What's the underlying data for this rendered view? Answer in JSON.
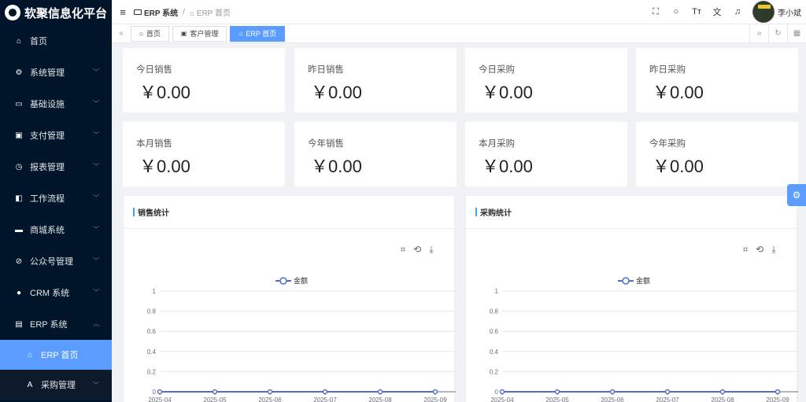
{
  "app": {
    "name": "软聚信息化平台"
  },
  "sidebar": {
    "items": [
      {
        "label": "首页",
        "icon": "home-icon",
        "glyph": "⌂",
        "has_children": false
      },
      {
        "label": "系统管理",
        "icon": "gear-icon",
        "glyph": "⚙",
        "has_children": true
      },
      {
        "label": "基础设施",
        "icon": "monitor-icon",
        "glyph": "▭",
        "has_children": true
      },
      {
        "label": "支付管理",
        "icon": "payment-icon",
        "glyph": "▣",
        "has_children": true
      },
      {
        "label": "报表管理",
        "icon": "report-icon",
        "glyph": "◷",
        "has_children": true
      },
      {
        "label": "工作流程",
        "icon": "workflow-icon",
        "glyph": "◧",
        "has_children": true
      },
      {
        "label": "商城系统",
        "icon": "shop-icon",
        "glyph": "▬",
        "has_children": true
      },
      {
        "label": "公众号管理",
        "icon": "compass-icon",
        "glyph": "⊘",
        "has_children": true
      },
      {
        "label": "CRM 系统",
        "icon": "user-icon",
        "glyph": "●",
        "has_children": true
      },
      {
        "label": "ERP 系统",
        "icon": "erp-icon",
        "glyph": "▤",
        "has_children": true,
        "expanded": true
      }
    ],
    "erp_children": [
      {
        "label": "ERP 首页",
        "icon": "home-icon",
        "glyph": "⌂",
        "active": true
      },
      {
        "label": "采购管理",
        "icon": "purchase-icon",
        "glyph": "A",
        "has_children": true
      }
    ]
  },
  "topbar": {
    "breadcrumb": [
      "ERP 系统",
      "ERP 首页"
    ],
    "username": "李小斌",
    "icons": [
      "fullscreen-icon",
      "search-icon",
      "font-size-icon",
      "translate-icon",
      "bell-icon"
    ]
  },
  "tabs": [
    {
      "label": "首页",
      "icon": "home-icon",
      "glyph": "⌂",
      "active": false
    },
    {
      "label": "客户管理",
      "icon": "card-icon",
      "glyph": "▣",
      "active": false
    },
    {
      "label": "ERP 首页",
      "icon": "home-icon",
      "glyph": "⌂",
      "active": true
    }
  ],
  "stats": [
    {
      "label": "今日销售",
      "value": "￥0.00"
    },
    {
      "label": "昨日销售",
      "value": "￥0.00"
    },
    {
      "label": "今日采购",
      "value": "￥0.00"
    },
    {
      "label": "昨日采购",
      "value": "￥0.00"
    },
    {
      "label": "本月销售",
      "value": "￥0.00"
    },
    {
      "label": "今年销售",
      "value": "￥0.00"
    },
    {
      "label": "本月采购",
      "value": "￥0.00"
    },
    {
      "label": "今年采购",
      "value": "￥0.00"
    }
  ],
  "chart_data": [
    {
      "type": "line",
      "title": "销售统计",
      "x": [
        "2025-04",
        "2025-05",
        "2025-06",
        "2025-07",
        "2025-08",
        "2025-09"
      ],
      "series": [
        {
          "name": "金额",
          "values": [
            0,
            0,
            0,
            0,
            0,
            0
          ]
        }
      ],
      "ylim": [
        0,
        1
      ],
      "yticks": [
        "0",
        "0.2",
        "0.4",
        "0.6",
        "0.8",
        "1"
      ],
      "legend": "top-center",
      "grid": true,
      "color": "#5470c6"
    },
    {
      "type": "line",
      "title": "采购统计",
      "x": [
        "2025-04",
        "2025-05",
        "2025-06",
        "2025-07",
        "2025-08",
        "2025-09"
      ],
      "series": [
        {
          "name": "金额",
          "values": [
            0,
            0,
            0,
            0,
            0,
            0
          ]
        }
      ],
      "ylim": [
        0,
        1
      ],
      "yticks": [
        "0",
        "0.2",
        "0.4",
        "0.6",
        "0.8",
        "1"
      ],
      "legend": "top-center",
      "grid": true,
      "color": "#5470c6"
    }
  ]
}
